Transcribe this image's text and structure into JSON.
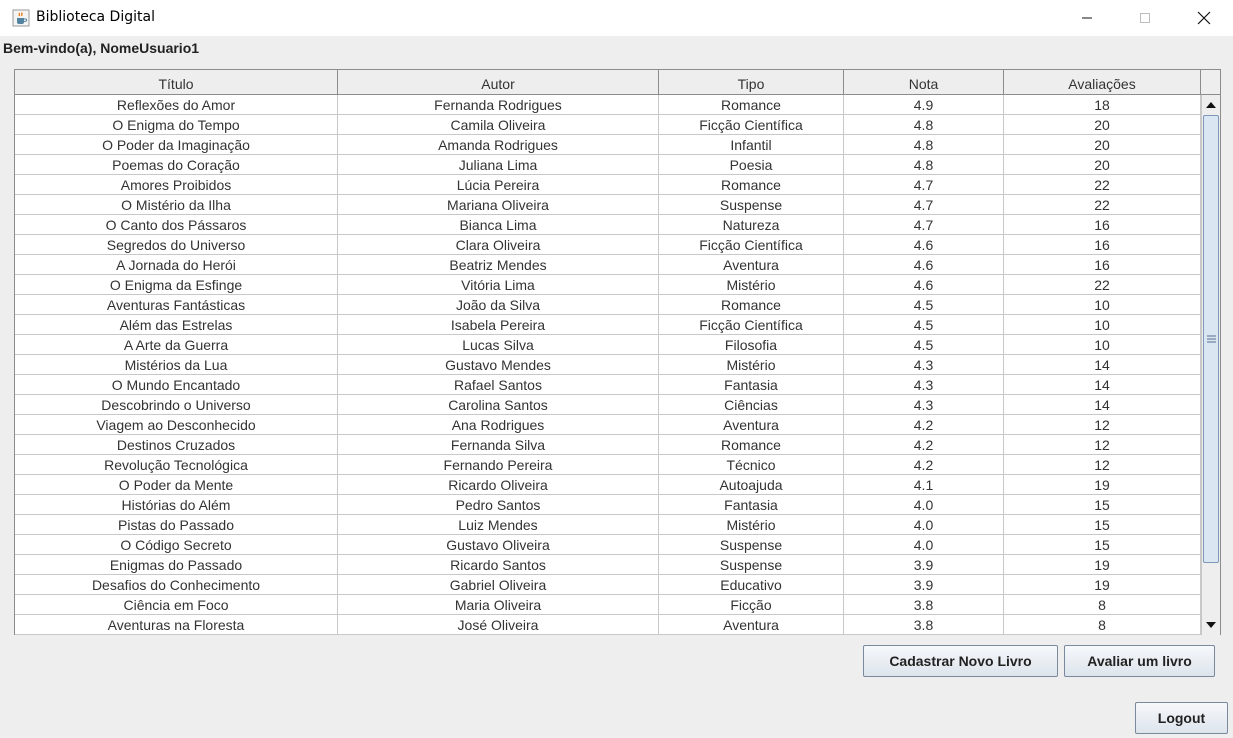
{
  "window": {
    "title": "Biblioteca Digital",
    "icon": "java-coffee-icon",
    "controls": [
      "minimize-icon",
      "maximize-icon",
      "close-icon"
    ]
  },
  "welcome": "Bem-vindo(a), NomeUsuario1",
  "table": {
    "columns": [
      "Título",
      "Autor",
      "Tipo",
      "Nota",
      "Avaliações"
    ],
    "rows": [
      [
        "Reflexões do Amor",
        "Fernanda Rodrigues",
        "Romance",
        "4.9",
        "18"
      ],
      [
        "O Enigma do Tempo",
        "Camila Oliveira",
        "Ficção Científica",
        "4.8",
        "20"
      ],
      [
        "O Poder da Imaginação",
        "Amanda Rodrigues",
        "Infantil",
        "4.8",
        "20"
      ],
      [
        "Poemas do Coração",
        "Juliana Lima",
        "Poesia",
        "4.8",
        "20"
      ],
      [
        "Amores Proibidos",
        "Lúcia Pereira",
        "Romance",
        "4.7",
        "22"
      ],
      [
        "O Mistério da Ilha",
        "Mariana Oliveira",
        "Suspense",
        "4.7",
        "22"
      ],
      [
        "O Canto dos Pássaros",
        "Bianca Lima",
        "Natureza",
        "4.7",
        "16"
      ],
      [
        "Segredos do Universo",
        "Clara Oliveira",
        "Ficção Científica",
        "4.6",
        "16"
      ],
      [
        "A Jornada do Herói",
        "Beatriz Mendes",
        "Aventura",
        "4.6",
        "16"
      ],
      [
        "O Enigma da Esfinge",
        "Vitória Lima",
        "Mistério",
        "4.6",
        "22"
      ],
      [
        "Aventuras Fantásticas",
        "João da Silva",
        "Romance",
        "4.5",
        "10"
      ],
      [
        "Além das Estrelas",
        "Isabela Pereira",
        "Ficção Científica",
        "4.5",
        "10"
      ],
      [
        "A Arte da Guerra",
        "Lucas Silva",
        "Filosofia",
        "4.5",
        "10"
      ],
      [
        "Mistérios da Lua",
        "Gustavo Mendes",
        "Mistério",
        "4.3",
        "14"
      ],
      [
        "O Mundo Encantado",
        "Rafael Santos",
        "Fantasia",
        "4.3",
        "14"
      ],
      [
        "Descobrindo o Universo",
        "Carolina Santos",
        "Ciências",
        "4.3",
        "14"
      ],
      [
        "Viagem ao Desconhecido",
        "Ana Rodrigues",
        "Aventura",
        "4.2",
        "12"
      ],
      [
        "Destinos Cruzados",
        "Fernanda Silva",
        "Romance",
        "4.2",
        "12"
      ],
      [
        "Revolução Tecnológica",
        "Fernando Pereira",
        "Técnico",
        "4.2",
        "12"
      ],
      [
        "O Poder da Mente",
        "Ricardo Oliveira",
        "Autoajuda",
        "4.1",
        "19"
      ],
      [
        "Histórias do Além",
        "Pedro Santos",
        "Fantasia",
        "4.0",
        "15"
      ],
      [
        "Pistas do Passado",
        "Luiz Mendes",
        "Mistério",
        "4.0",
        "15"
      ],
      [
        "O Código Secreto",
        "Gustavo Oliveira",
        "Suspense",
        "4.0",
        "15"
      ],
      [
        "Enigmas do Passado",
        "Ricardo Santos",
        "Suspense",
        "3.9",
        "19"
      ],
      [
        "Desafios do Conhecimento",
        "Gabriel Oliveira",
        "Educativo",
        "3.9",
        "19"
      ],
      [
        "Ciência em Foco",
        "Maria Oliveira",
        "Ficção",
        "3.8",
        "8"
      ],
      [
        "Aventuras na Floresta",
        "José Oliveira",
        "Aventura",
        "3.8",
        "8"
      ]
    ]
  },
  "buttons": {
    "register": "Cadastrar Novo Livro",
    "rate": "Avaliar um livro",
    "logout": "Logout"
  },
  "colors": {
    "scroll_thumb": "#dbe6f3",
    "grid": "#c8c8c8"
  }
}
